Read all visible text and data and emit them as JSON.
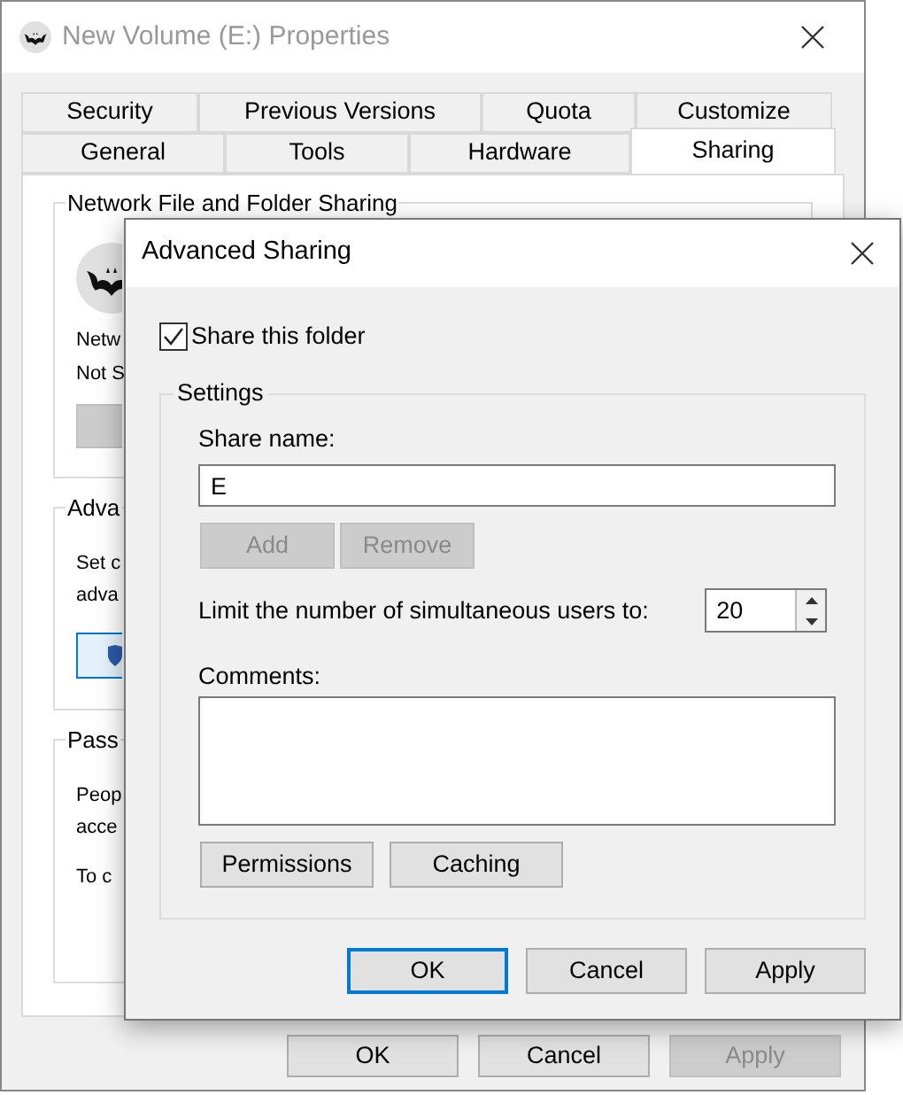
{
  "properties_window": {
    "title": "New Volume (E:) Properties",
    "tab_rows": [
      [
        {
          "label": "Security",
          "selected": false
        },
        {
          "label": "Previous Versions",
          "selected": false
        },
        {
          "label": "Quota",
          "selected": false
        },
        {
          "label": "Customize",
          "selected": false
        }
      ],
      [
        {
          "label": "General",
          "selected": false
        },
        {
          "label": "Tools",
          "selected": false
        },
        {
          "label": "Hardware",
          "selected": false
        },
        {
          "label": "Sharing",
          "selected": true
        }
      ]
    ],
    "groups": [
      {
        "kind": "network",
        "title": "Network File and Folder Sharing",
        "lines": [
          "Netw",
          "Not S"
        ]
      },
      {
        "kind": "advanced",
        "title": "Adva",
        "lines": [
          "Set c",
          "adva"
        ]
      },
      {
        "kind": "password",
        "title": "Pass",
        "lines": [
          "Peop",
          "acce",
          "To c"
        ]
      }
    ],
    "buttons": [
      {
        "label": "OK",
        "disabled": false
      },
      {
        "label": "Cancel",
        "disabled": false
      },
      {
        "label": "Apply",
        "disabled": true
      }
    ]
  },
  "dialog": {
    "title": "Advanced Sharing",
    "share_checkbox": {
      "label": "Share this folder",
      "checked": true
    },
    "settings": {
      "title": "Settings",
      "share_name_label": "Share name:",
      "share_name": "E",
      "name_buttons": [
        {
          "label": "Add",
          "disabled": true
        },
        {
          "label": "Remove",
          "disabled": true
        }
      ],
      "limit_label": "Limit the number of simultaneous users to:",
      "limit_value": "20",
      "comments_label": "Comments:",
      "action_buttons": [
        "Permissions",
        "Caching"
      ]
    },
    "buttons": [
      {
        "label": "OK",
        "default": true
      },
      {
        "label": "Cancel",
        "default": false
      },
      {
        "label": "Apply",
        "default": false
      }
    ]
  }
}
